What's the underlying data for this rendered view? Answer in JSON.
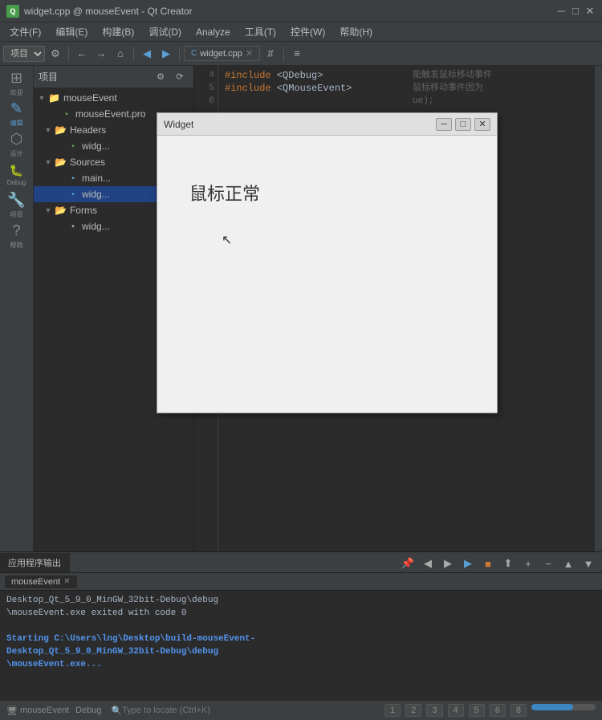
{
  "titlebar": {
    "icon": "Q",
    "title": "widget.cpp @ mouseEvent - Qt Creator",
    "minimize": "─",
    "maximize": "□",
    "close": "✕"
  },
  "menubar": {
    "items": [
      "文件(F)",
      "编辑(E)",
      "构建(B)",
      "调试(D)",
      "Analyze",
      "工具(T)",
      "控件(W)",
      "帮助(H)"
    ]
  },
  "toolbar": {
    "project_dropdown": "项目",
    "tab_label": "widget.cpp"
  },
  "sidebar": {
    "icons": [
      {
        "name": "欢迎",
        "symbol": "⊞"
      },
      {
        "name": "编辑",
        "symbol": "✎"
      },
      {
        "name": "设计",
        "symbol": "⬡"
      },
      {
        "name": "Debug",
        "symbol": "🐞"
      },
      {
        "name": "项目",
        "symbol": "🔧"
      },
      {
        "name": "帮助",
        "symbol": "?"
      }
    ]
  },
  "tree": {
    "header": "项目",
    "nodes": [
      {
        "label": "mouseEvent",
        "depth": 0,
        "type": "project",
        "expanded": true
      },
      {
        "label": "mouseEvent.pro",
        "depth": 1,
        "type": "pro"
      },
      {
        "label": "Headers",
        "depth": 1,
        "type": "folder",
        "expanded": true
      },
      {
        "label": "widg...",
        "depth": 2,
        "type": "header"
      },
      {
        "label": "Sources",
        "depth": 1,
        "type": "folder",
        "expanded": true
      },
      {
        "label": "main...",
        "depth": 2,
        "type": "source"
      },
      {
        "label": "widg...",
        "depth": 2,
        "type": "source"
      },
      {
        "label": "Forms",
        "depth": 1,
        "type": "folder",
        "expanded": true
      },
      {
        "label": "widg...",
        "depth": 2,
        "type": "form"
      }
    ]
  },
  "code": {
    "tab": "widget.cpp",
    "lines": [
      "4",
      "5",
      "6"
    ],
    "content": [
      "#include <QDebug>",
      "#include <QMouseEvent>",
      ""
    ]
  },
  "right_comments": [
    "能触发鼠标移动事件",
    "鼠标移动事件因为",
    "ue);"
  ],
  "code_right2": [
    ");",
    ""
  ],
  "widget_window": {
    "title": "Widget",
    "text": "鼠标正常",
    "controls": [
      "─",
      "□",
      "✕"
    ]
  },
  "output": {
    "tab": "应用程序输出",
    "process_tab": "mouseEvent",
    "lines": [
      "Desktop_Qt_5_9_0_MinGW_32bit-Debug\\debug",
      "\\mouseEvent.exe exited with code 0",
      "",
      "Starting C:\\Users\\lng\\Desktop\\build-mouseEvent-",
      "Desktop_Qt_5_9_0_MinGW_32bit-Debug\\debug",
      "\\mouseEvent.exe..."
    ]
  },
  "statusbar": {
    "items": [
      "mouseEvent",
      "Debug"
    ],
    "page_numbers": [
      "1",
      "2",
      "3",
      "4",
      "5",
      "6",
      "8"
    ],
    "progress_pct": 65,
    "search_placeholder": "Type to locate (Ctrl+K)"
  }
}
